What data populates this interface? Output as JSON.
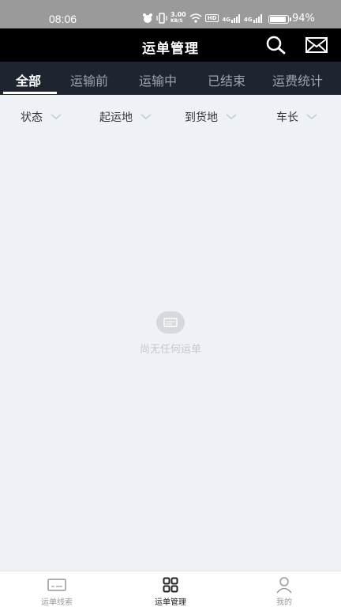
{
  "status_bar": {
    "time": "08:06",
    "net_speed": "3.00",
    "net_unit": "KB/S",
    "hd_label": "HD",
    "signal1": "4G",
    "signal2": "4G",
    "battery": "94%",
    "battery_level": 0.94
  },
  "header": {
    "title": "运单管理",
    "search_icon": "search-icon",
    "mail_icon": "mail-icon"
  },
  "tabs": [
    {
      "label": "全部",
      "active": true
    },
    {
      "label": "运输前",
      "active": false
    },
    {
      "label": "运输中",
      "active": false
    },
    {
      "label": "已结束",
      "active": false
    },
    {
      "label": "运费统计",
      "active": false
    }
  ],
  "filters": [
    {
      "label": "状态"
    },
    {
      "label": "起运地"
    },
    {
      "label": "到货地"
    },
    {
      "label": "车长"
    }
  ],
  "empty_state": {
    "text": "尚无任何运单"
  },
  "bottom_nav": [
    {
      "label": "运单线索",
      "icon": "ticket-icon",
      "active": false
    },
    {
      "label": "运单管理",
      "icon": "grid-icon",
      "active": true
    },
    {
      "label": "我的",
      "icon": "user-icon",
      "active": false
    }
  ],
  "colors": {
    "header_bg": "#000000",
    "tabs_bg": "#1e2530",
    "page_bg": "#eef2f6",
    "status_bg": "#9a9a9a"
  }
}
